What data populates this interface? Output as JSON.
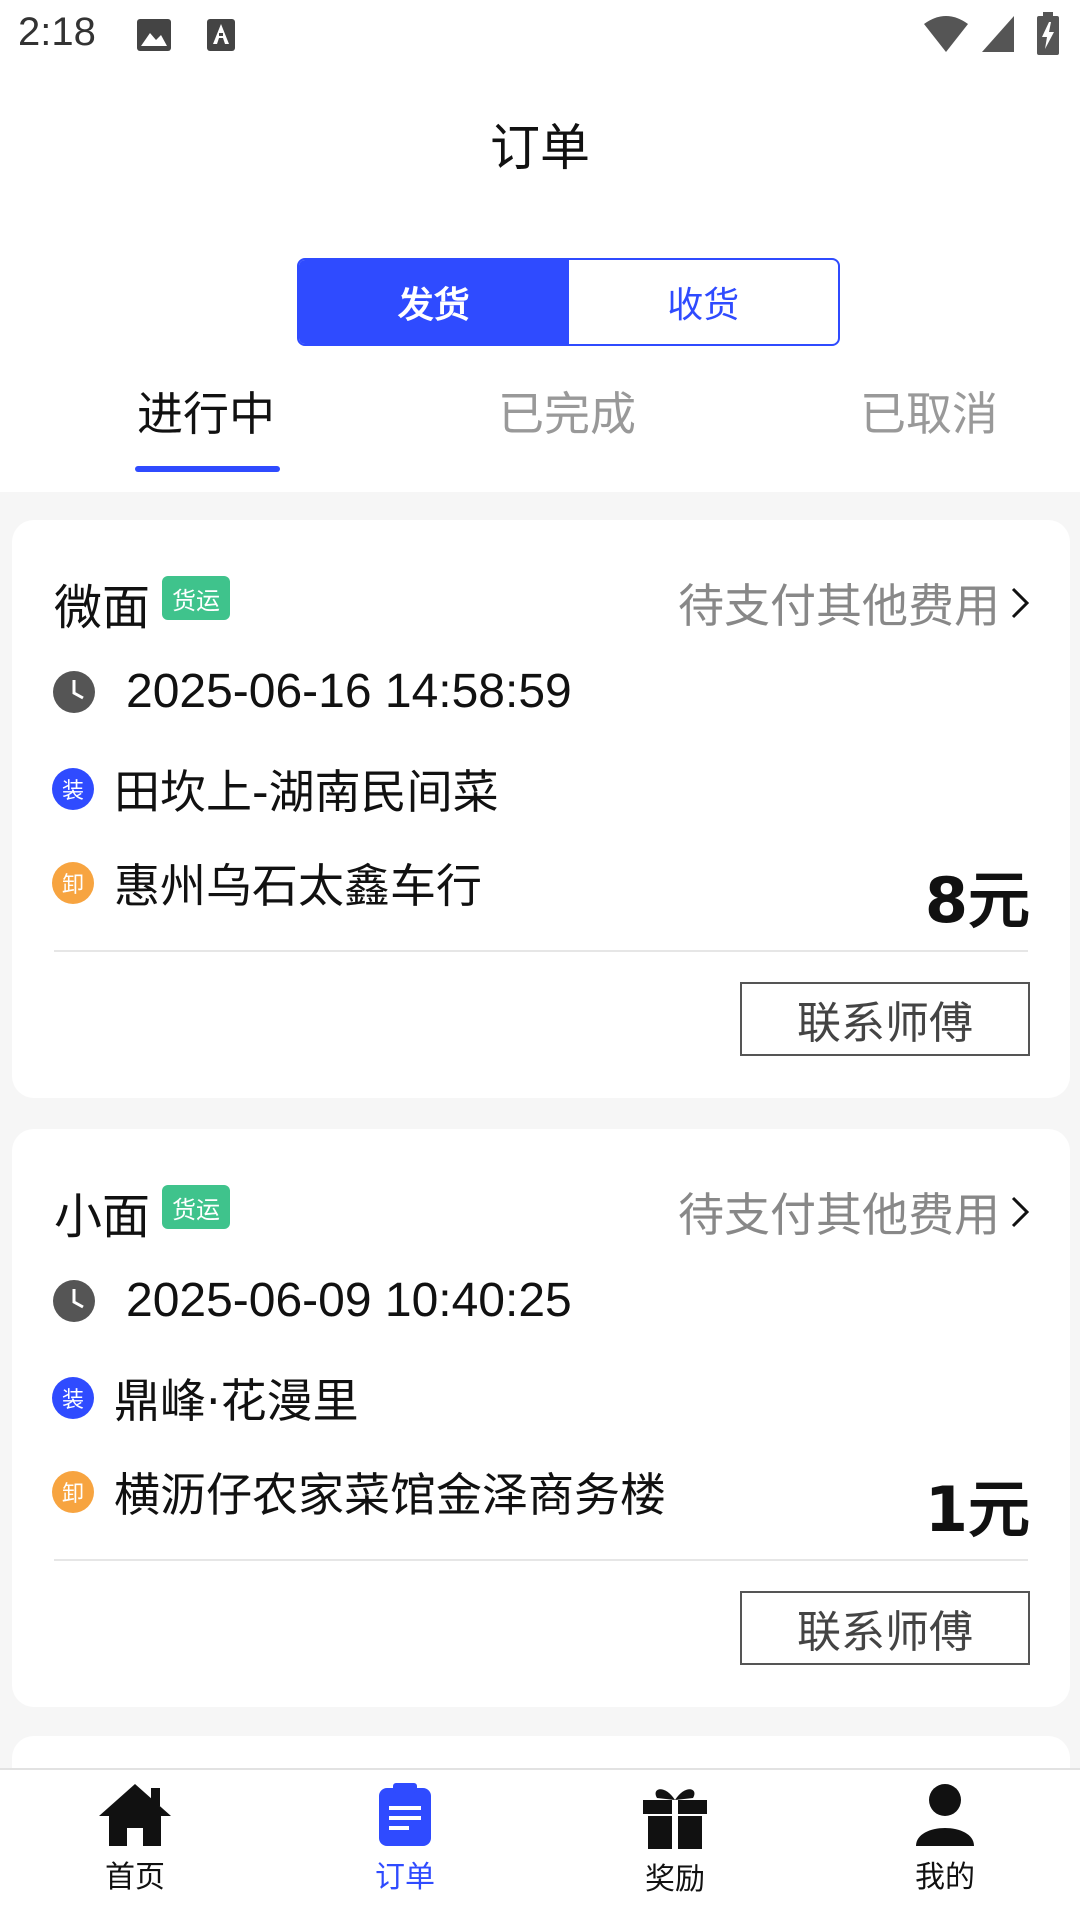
{
  "status_bar": {
    "time": "2:18"
  },
  "header": {
    "title": "订单"
  },
  "segment": {
    "options": [
      "发货",
      "收货"
    ],
    "selected": "发货"
  },
  "tabs": [
    "进行中",
    "已完成",
    "已取消"
  ],
  "orders": [
    {
      "vehicle": "微面",
      "tag": "货运",
      "status": "待支付其他费用",
      "time": "2025-06-16 14:58:59",
      "load_badge": "装",
      "load": "田坎上-湖南民间菜",
      "unload_badge": "卸",
      "unload": "惠州乌石太鑫车行",
      "price": "8元",
      "action": "联系师傅"
    },
    {
      "vehicle": "小面",
      "tag": "货运",
      "status": "待支付其他费用",
      "time": "2025-06-09 10:40:25",
      "load_badge": "装",
      "load": "鼎峰·花漫里",
      "unload_badge": "卸",
      "unload": "横沥仔农家菜馆金泽商务楼",
      "price": "1元",
      "action": "联系师傅"
    }
  ],
  "bottom_nav": [
    {
      "label": "首页",
      "icon": "home-icon"
    },
    {
      "label": "订单",
      "icon": "order-icon",
      "active": true
    },
    {
      "label": "奖励",
      "icon": "gift-icon"
    },
    {
      "label": "我的",
      "icon": "user-icon"
    }
  ],
  "colors": {
    "accent": "#2f4bff",
    "tag": "#3fc38c",
    "unload": "#f7a440"
  }
}
